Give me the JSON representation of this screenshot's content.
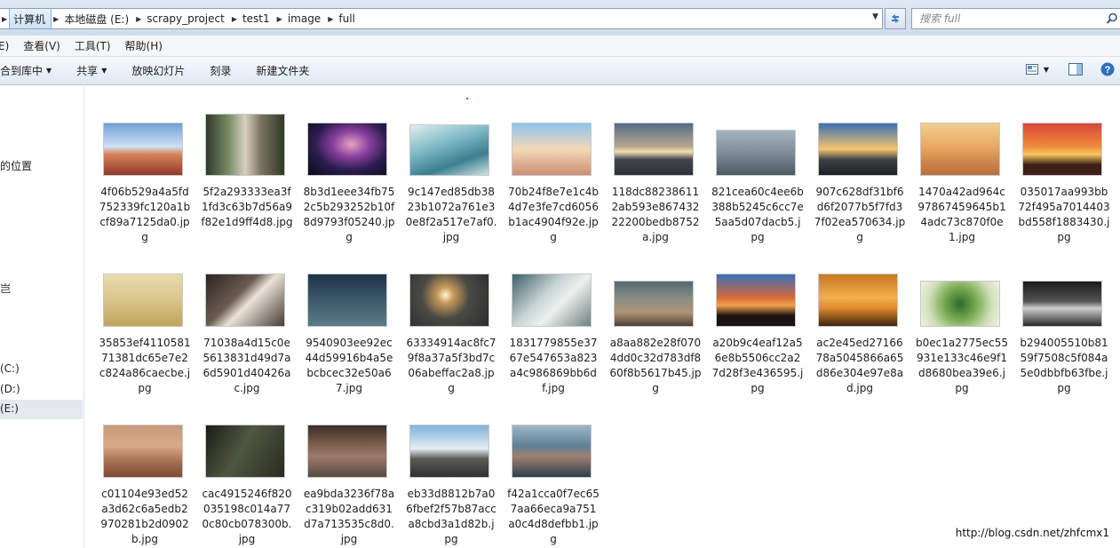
{
  "address": {
    "crumbs": [
      "计算机",
      "本地磁盘 (E:)",
      "scrapy_project",
      "test1",
      "image",
      "full"
    ],
    "search_placeholder": "搜索 full"
  },
  "menu": [
    "E)",
    "查看(V)",
    "工具(T)",
    "帮助(H)"
  ],
  "toolbar": {
    "include_library": "合到库中",
    "share": "共享",
    "slideshow": "放映幻灯片",
    "burn": "刻录",
    "new_folder": "新建文件夹"
  },
  "sidebar": {
    "locations": "的位置",
    "fragment": "岂",
    "drive_c": "(C:)",
    "drive_d": "(D:)",
    "drive_e": "(E:)"
  },
  "files": [
    {
      "name": "4f06b529a4a5fd752339fc120a1bcf89a7125da0.jpg",
      "thumb": "mountain-runner"
    },
    {
      "name": "5f2a293333ea3f1fd3c63b7d56a9f82e1d9ff4d8.jpg",
      "thumb": "woman-outdoors"
    },
    {
      "name": "8b3d1eee34fb752c5b293252b10f8d9793f05240.jpg",
      "thumb": "milky-way"
    },
    {
      "name": "9c147ed85db3823b1072a761e30e8f2a517e7af0.jpg",
      "thumb": "sea-waves"
    },
    {
      "name": "70b24f8e7e1c4b4d7e3fe7cd6056b1ac4904f92e.jpg",
      "thumb": "friends-selfie"
    },
    {
      "name": "118dc882386112ab593e86743222200bedb8752a.jpg",
      "thumb": "cliff-sunset"
    },
    {
      "name": "821cea60c4ee6b388b5245c6cc7e5aa5d07dacb5.jpg",
      "thumb": "coast-sitting"
    },
    {
      "name": "907c628df31bf6d6f2077b5f7fd37f02ea570634.jpg",
      "thumb": "road-sunset"
    },
    {
      "name": "1470a42ad964c97867459645b14adc73c870f0e1.jpg",
      "thumb": "mother-child-beach"
    },
    {
      "name": "035017aa993bb72f495a7014403bd558f1883430.jpg",
      "thumb": "jumping-silhouettes"
    },
    {
      "name": "35853ef411058171381dc65e7e2c824a86caecbe.jpg",
      "thumb": "girl-sunglasses"
    },
    {
      "name": "71038a4d15c0e5613831d49d7a6d5901d40426ac.jpg",
      "thumb": "desk-writing"
    },
    {
      "name": "9540903ee92ec44d59916b4a5ebcbcec32e50a67.jpg",
      "thumb": "little-boy"
    },
    {
      "name": "63334914ac8fc79f8a37a5f3bd7c06abeffac2a8.jpg",
      "thumb": "sparkler"
    },
    {
      "name": "1831779855e3767e547653a823a4c986869bb6df.jpg",
      "thumb": "hand-writing"
    },
    {
      "name": "a8aa882e28f0704dd0c32d783df860f8b5617b45.jpg",
      "thumb": "child-teddy"
    },
    {
      "name": "a20b9c4eaf12a56e8b5506cc2a27d28f3e436595.jpg",
      "thumb": "crowd-sunset"
    },
    {
      "name": "ac2e45ed2716678a5045866a65d86e304e97e8ad.jpg",
      "thumb": "runner-sunset"
    },
    {
      "name": "b0ec1a2775ec55931e133c46e9f1d8680bea39e6.jpg",
      "thumb": "hands-circle"
    },
    {
      "name": "b294005510b8159f7508c5f084a5e0dbbfb63fbe.jpg",
      "thumb": "sprinter-start"
    },
    {
      "name": "c01104e93ed52a3d62c6a5edb2970281b2d0902b.jpg",
      "thumb": "person-road"
    },
    {
      "name": "cac4915246f820035198c014a770c80cb078300b.jpg",
      "thumb": "man-suit"
    },
    {
      "name": "ea9bda3236f78ac319b02add631d7a713535c8d0.jpg",
      "thumb": "girl-street"
    },
    {
      "name": "eb33d8812b7a06fbef2f57b87acca8cbd3a1d82b.jpg",
      "thumb": "mountain-peak"
    },
    {
      "name": "f42a1cca0f7ec657aa66eca9a751a0c4d8defbb1.jpg",
      "thumb": "woman-portrait"
    }
  ],
  "watermark": "http://blog.csdn.net/zhfcmx1"
}
